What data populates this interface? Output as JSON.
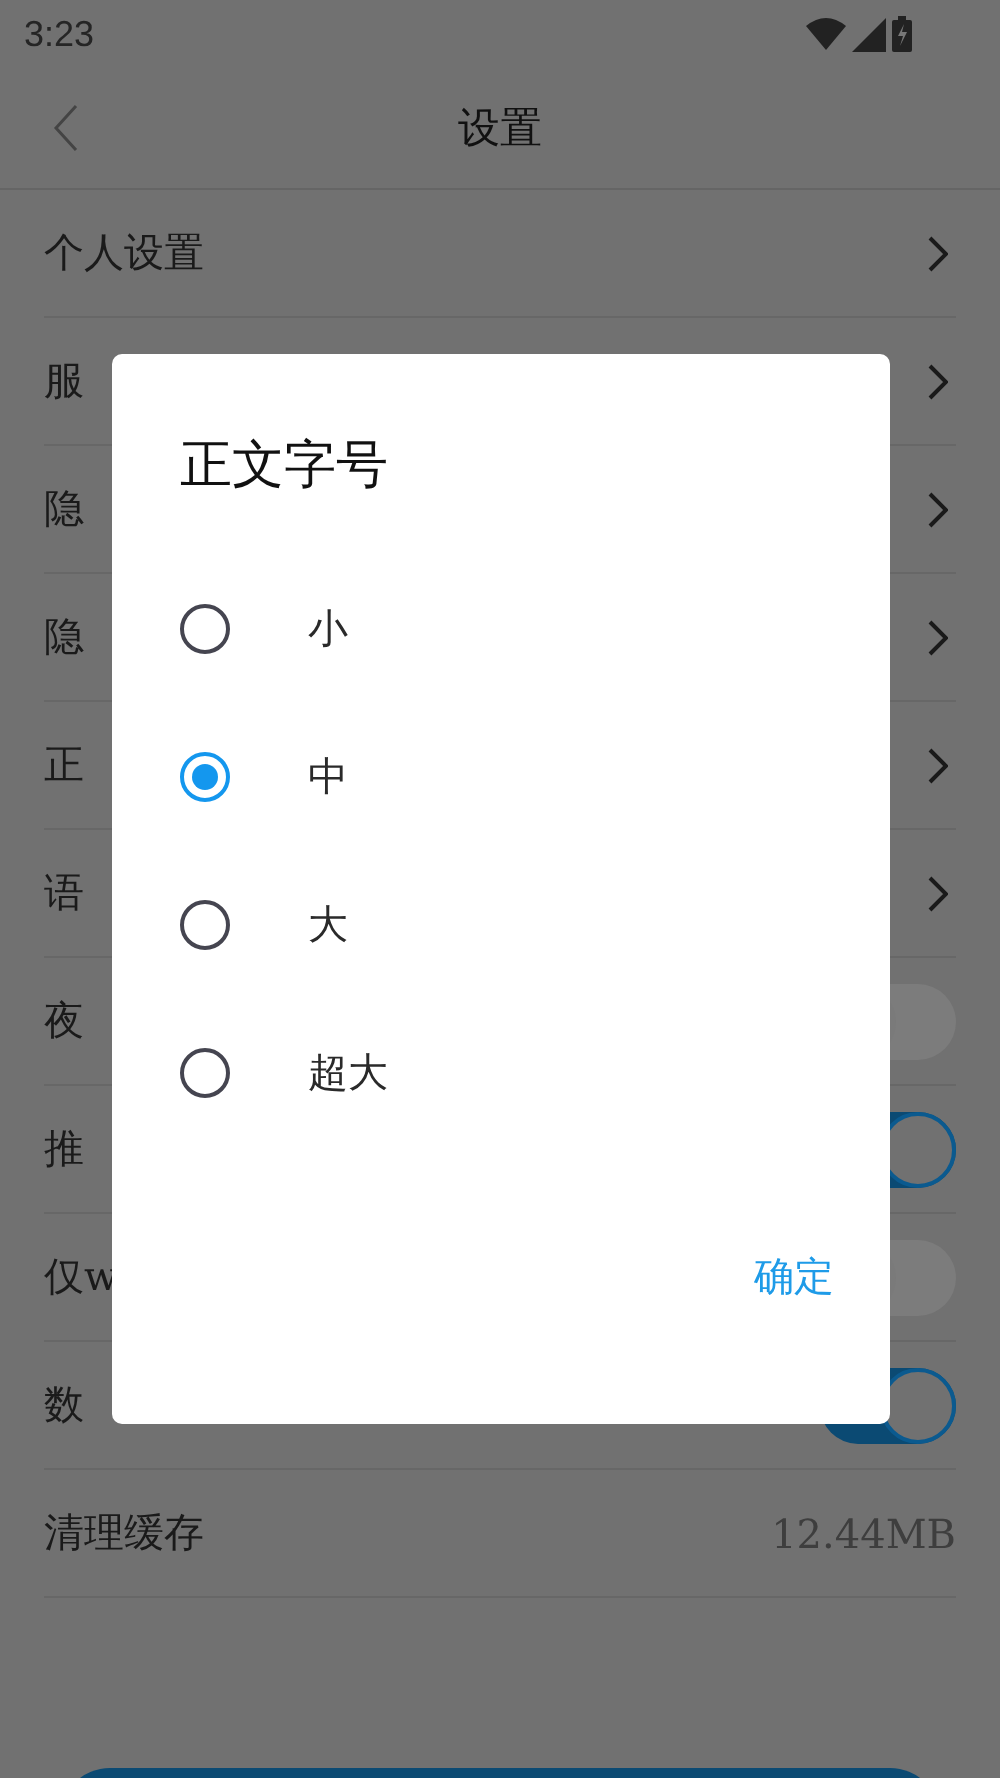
{
  "status_bar": {
    "time": "3:23"
  },
  "header": {
    "title": "设置"
  },
  "settings": [
    {
      "kind": "link",
      "label": "个人设置"
    },
    {
      "kind": "link",
      "label": "服"
    },
    {
      "kind": "link",
      "label": "隐"
    },
    {
      "kind": "link",
      "label": "隐"
    },
    {
      "kind": "link",
      "label": "正"
    },
    {
      "kind": "link",
      "label": "语"
    },
    {
      "kind": "toggle",
      "label": "夜",
      "on": false
    },
    {
      "kind": "toggle",
      "label": "推",
      "on": true
    },
    {
      "kind": "toggle",
      "label": "仅w",
      "on": false
    },
    {
      "kind": "toggle",
      "label": "数",
      "on": true
    },
    {
      "kind": "value",
      "label": "清理缓存",
      "value": "12.44MB"
    }
  ],
  "dialog": {
    "title": "正文字号",
    "options": [
      {
        "label": "小",
        "selected": false
      },
      {
        "label": "中",
        "selected": true
      },
      {
        "label": "大",
        "selected": false
      },
      {
        "label": "超大",
        "selected": false
      }
    ],
    "confirm": "确定"
  }
}
